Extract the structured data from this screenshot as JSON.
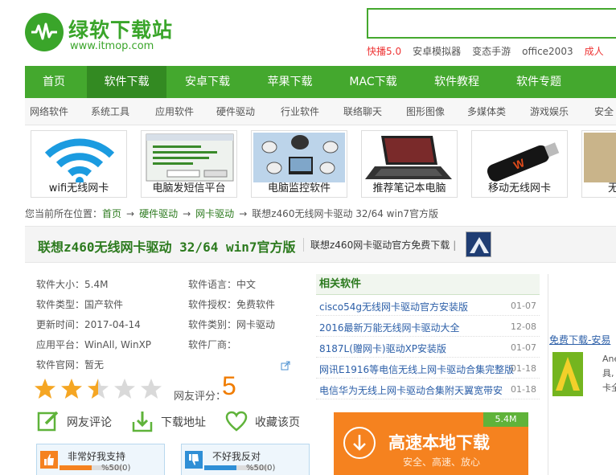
{
  "header": {
    "logo_name": "绿软下载站",
    "logo_url": "www.itmop.com",
    "search_placeholder": "",
    "hotlinks": [
      {
        "label": "快播5.0",
        "hot": true
      },
      {
        "label": "安卓模拟器",
        "hot": false
      },
      {
        "label": "变态手游",
        "hot": false
      },
      {
        "label": "office2003",
        "hot": false
      },
      {
        "label": "成人",
        "hot": true
      }
    ]
  },
  "mainnav": [
    "首页",
    "软件下载",
    "安卓下载",
    "苹果下载",
    "MAC下载",
    "软件教程",
    "软件专题"
  ],
  "mainnav_active": 1,
  "subnav": [
    "网络软件",
    "系统工具",
    "应用软件",
    "硬件驱动",
    "行业软件",
    "联络聊天",
    "图形图像",
    "多媒体类",
    "游戏娱乐",
    "安全"
  ],
  "thumbs": [
    {
      "caption": "wifi无线网卡",
      "icon": "wifi-icon"
    },
    {
      "caption": "电脑发短信平台",
      "icon": "sms-window-icon"
    },
    {
      "caption": "电脑监控软件",
      "icon": "cctv-camera-icon"
    },
    {
      "caption": "推荐笔记本电脑",
      "icon": "laptop-icon"
    },
    {
      "caption": "移动无线网卡",
      "icon": "usb-modem-icon"
    },
    {
      "caption": "无",
      "icon": "partial-thumb"
    }
  ],
  "breadcrumb": {
    "prefix": "您当前所在位置：",
    "items": [
      "首页",
      "硬件驱动",
      "网卡驱动"
    ],
    "current": "联想z460无线网卡驱动 32/64 win7官方版",
    "arrow": "→"
  },
  "title": {
    "main": "联想z460无线网卡驱动 32/64 win7官方版",
    "sub": "联想z460网卡驱动官方免费下载"
  },
  "info": {
    "size": "软件大小：5.4M",
    "language": "软件语言：中文",
    "type": "软件类型：国产软件",
    "license": "软件授权：免费软件",
    "updated": "更新时间：2017-04-14",
    "category": "软件类别：网卡驱动",
    "platform": "应用平台：WinAll, WinXP",
    "vendor": "软件厂商：",
    "website": "软件官网：暂无"
  },
  "rating": {
    "label": "网友评分：",
    "value": "5",
    "stars_filled": 2.5,
    "stars_total": 5
  },
  "actions": [
    {
      "label": "网友评论",
      "icon": "comment-edit-icon"
    },
    {
      "label": "下载地址",
      "icon": "download-arrow-icon"
    },
    {
      "label": "收藏该页",
      "icon": "heart-icon"
    }
  ],
  "votes": {
    "up": {
      "title": "非常好我支持",
      "count": "%50(0)",
      "ratio": 0.5,
      "color": "#f5821f"
    },
    "down": {
      "title": "不好我反对",
      "count": "%50(0)",
      "ratio": 0.5,
      "color": "#2f8fd6"
    }
  },
  "related": {
    "heading": "相关软件",
    "items": [
      {
        "title": "cisco54g无线网卡驱动官方安装版",
        "date": "01-07"
      },
      {
        "title": "2016最新万能无线网卡驱动大全",
        "date": "12-08"
      },
      {
        "title": "8187L(赠网卡)驱动XP安装版",
        "date": "01-07"
      },
      {
        "title": "网讯E1916等电信无线上网卡驱动合集完整版",
        "date": "01-18"
      },
      {
        "title": "电信华为无线上网卡驱动合集附天翼宽带安",
        "date": "01-18"
      }
    ]
  },
  "download_button": {
    "label": "高速本地下载",
    "tag": "5.4M",
    "subline": "安全、高速、放心"
  },
  "ad": {
    "title": "免费下载-安易",
    "text_lines": [
      "Ane",
      "具,",
      "卡全"
    ]
  },
  "colors": {
    "brand_green": "#44a82e",
    "active_green": "#338a22",
    "link_blue": "#2c5fa8",
    "orange": "#f5821f",
    "star": "#f5a623"
  }
}
